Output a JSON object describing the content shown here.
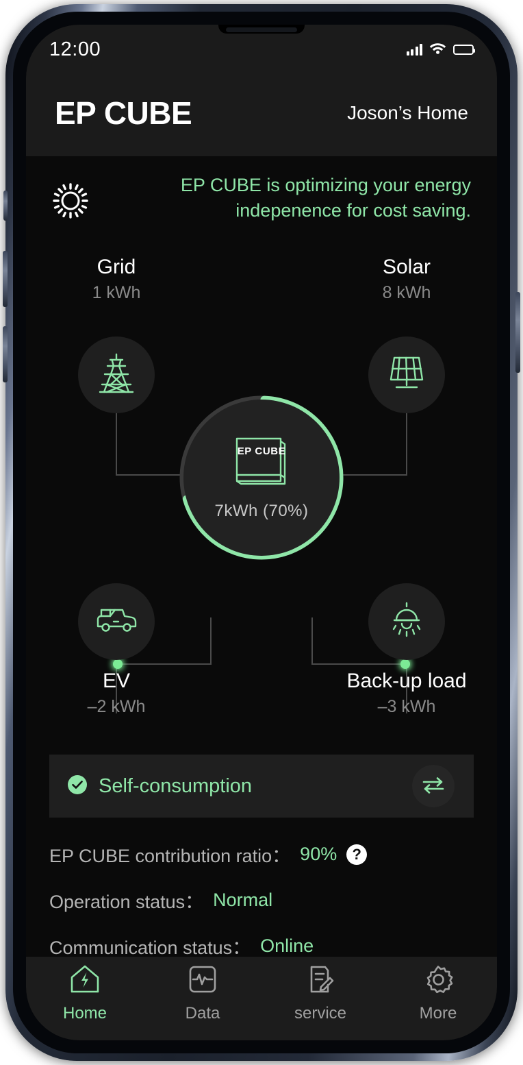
{
  "theme": {
    "accent_green": "#8FE6A8",
    "flow_green": "#3ED06A",
    "screen_bg": "#0a0a0a",
    "header_bg": "#1b1b1b",
    "card_bg": "#1f1f1f",
    "muted_text": "#8a8a8a"
  },
  "status_bar": {
    "time": "12:00",
    "signal_icon": "cellular-signal-icon",
    "wifi_icon": "wifi-icon",
    "battery_icon": "battery-full-icon"
  },
  "header": {
    "brand": "EP CUBE",
    "home_name": "Joson’s Home"
  },
  "status_message": {
    "icon": "sun-icon",
    "text": "EP CUBE is optimizing your energy indepenence for cost saving."
  },
  "flow": {
    "nodes": [
      {
        "id": "grid",
        "label": "Grid",
        "value": "1 kWh",
        "icon": "power-tower-icon",
        "direction": "in"
      },
      {
        "id": "solar",
        "label": "Solar",
        "value": "8 kWh",
        "icon": "solar-panel-icon",
        "direction": "in"
      },
      {
        "id": "ev",
        "label": "EV",
        "value": "–2 kWh",
        "icon": "car-icon",
        "direction": "out"
      },
      {
        "id": "load",
        "label": "Back-up load",
        "value": "–3 kWh",
        "icon": "lamp-icon",
        "direction": "out"
      }
    ],
    "battery": {
      "brand_label": "EP CUBE",
      "capacity_text": "7kWh  (70%)",
      "charge_percent": 70,
      "icon": "battery-cube-icon"
    }
  },
  "mode_bar": {
    "check_icon": "check-circle-icon",
    "label": "Self-consumption",
    "toggle_icon": "swap-arrows-icon"
  },
  "status_list": [
    {
      "label": "EP CUBE contribution ratio：",
      "value": "90%",
      "help_icon": "help-circle-icon",
      "help_glyph": "?"
    },
    {
      "label": "Operation status：",
      "value": "Normal",
      "help_icon": null,
      "help_glyph": ""
    },
    {
      "label": "Communication status：",
      "value": "Online",
      "help_icon": null,
      "help_glyph": ""
    }
  ],
  "tab_bar": [
    {
      "label": "Home",
      "icon": "home-bolt-icon",
      "active": true
    },
    {
      "label": "Data",
      "icon": "pulse-chart-icon",
      "active": false
    },
    {
      "label": "service",
      "icon": "document-edit-icon",
      "active": false
    },
    {
      "label": "More",
      "icon": "gear-icon",
      "active": false
    }
  ]
}
